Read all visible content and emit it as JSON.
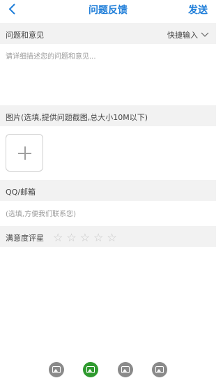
{
  "nav": {
    "back_icon": "chevron-left-icon",
    "title": "问题反馈",
    "send": "发送"
  },
  "issue": {
    "label": "问题和意见",
    "quick_input": "快捷输入",
    "placeholder": "请详细描述您的问题和意见..."
  },
  "images": {
    "label": "图片(选填,提供问题截图,总大小10M以下)",
    "add_icon": "plus-icon"
  },
  "contact": {
    "label": "QQ/邮箱",
    "placeholder": "(选填,方便我们联系您)"
  },
  "rating": {
    "label": "满意度评星",
    "value": 0,
    "max": 5
  },
  "tabs": {
    "count": 4,
    "active_index": 1
  },
  "colors": {
    "accent": "#1f7ed9",
    "section_bg": "#f2f2f2",
    "tab_active": "#2f9a2f",
    "tab_inactive": "#8a8a8a"
  }
}
